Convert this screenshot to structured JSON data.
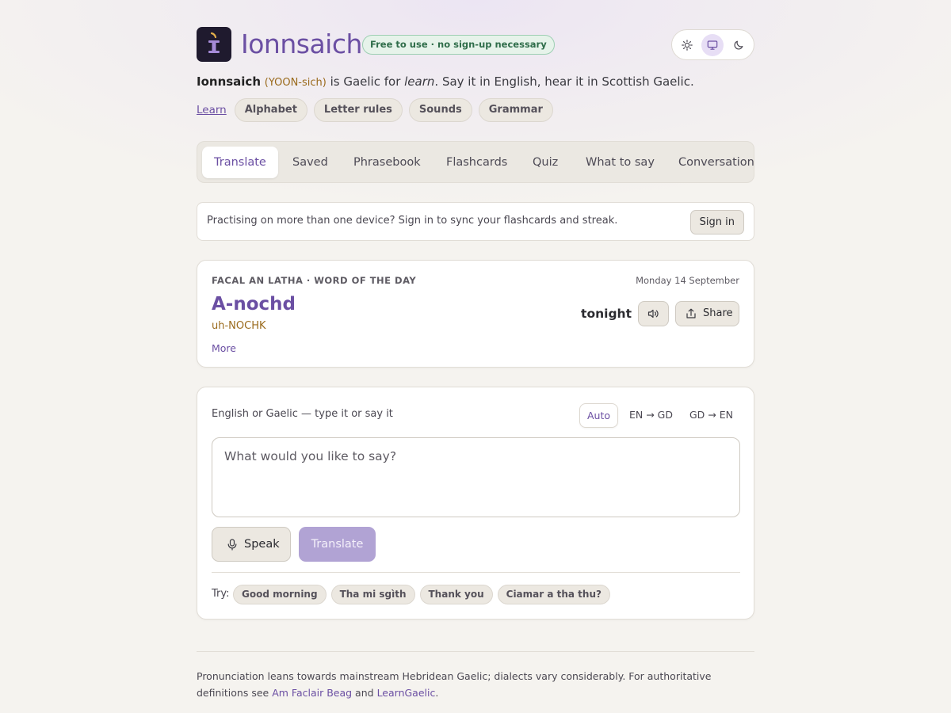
{
  "header": {
    "brand": "Ionnsaich",
    "badge": "Free to use · no sign-up necessary",
    "theme_options": [
      "light",
      "system",
      "dark"
    ],
    "theme_selected": "system"
  },
  "intro": {
    "word": "Ionnsaich",
    "pronunciation": "(YOON-sich)",
    "part1": " is Gaelic for ",
    "emphasis": "learn",
    "part2": ". Say it in English, hear it in Scottish Gaelic."
  },
  "learn_nav": {
    "link": "Learn",
    "chips": [
      "Alphabet",
      "Letter rules",
      "Sounds",
      "Grammar"
    ]
  },
  "tabs": [
    "Translate",
    "Saved",
    "Phrasebook",
    "Flashcards",
    "Quiz",
    "What to say",
    "Conversation"
  ],
  "active_tab": "Translate",
  "sync_banner": {
    "text": "Practising on more than one device? Sign in to sync your flashcards and streak.",
    "button": "Sign in"
  },
  "word_of_day": {
    "label": "FACAL AN LATHA · WORD OF THE DAY",
    "date": "Monday 14 September",
    "word": "A-nochd",
    "pronunciation": "uh-NOCHK",
    "more": "More",
    "english": "tonight",
    "share": "Share"
  },
  "translator": {
    "hint": "English or Gaelic — type it or say it",
    "directions": [
      "Auto",
      "EN → GD",
      "GD → EN"
    ],
    "direction_selected": "Auto",
    "placeholder": "What would you like to say?",
    "value": "",
    "speak": "Speak",
    "translate": "Translate",
    "try_label": "Try:",
    "suggestions": [
      "Good morning",
      "Tha mi sgìth",
      "Thank you",
      "Ciamar a tha thu?"
    ]
  },
  "footer": {
    "text": "Pronunciation leans towards mainstream Hebridean Gaelic; dialects vary considerably. For authoritative definitions see",
    "link1": "Am Faclair Beag",
    "and": "and",
    "link2": "LearnGaelic",
    "end": "."
  },
  "colors": {
    "accent": "#6b4fa3",
    "pronunciation": "#9a6a1c",
    "badge_green": "#2f6d4a",
    "background": "#f5f3ef",
    "translate_disabled": "#b1a3d4"
  }
}
